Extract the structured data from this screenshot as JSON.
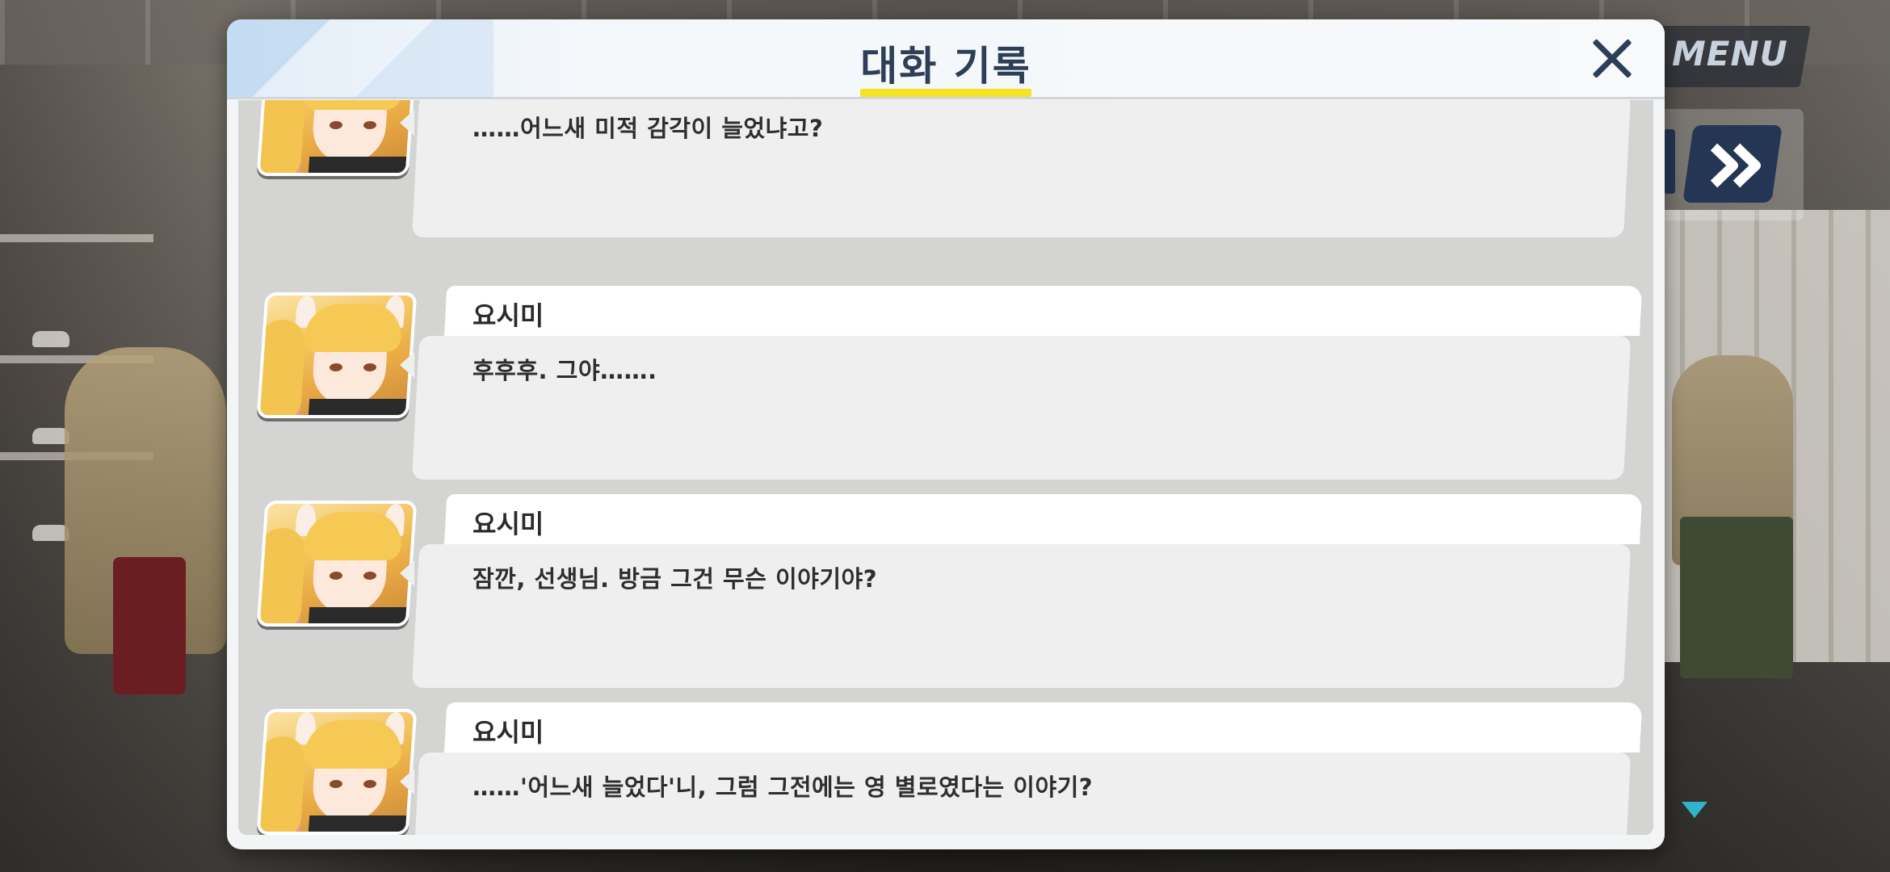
{
  "background": {
    "menu_label": "MENU"
  },
  "dialog": {
    "title": "대화 기록",
    "accent_color": "#f4e224",
    "title_color": "#2c3e58"
  },
  "entries": [
    {
      "speaker": "",
      "message": "……어느새 미적 감각이 늘었냐고?"
    },
    {
      "speaker": "요시미",
      "message": "후후후. 그야……."
    },
    {
      "speaker": "요시미",
      "message": "잠깐, 선생님. 방금 그건 무슨 이야기야?"
    },
    {
      "speaker": "요시미",
      "message": "……'어느새 늘었다'니, 그럼 그전에는 영 별로였다는 이야기?"
    }
  ],
  "icons": {
    "close": "close-icon",
    "skip": "fast-forward-icon",
    "scroll": "scroll-down-icon"
  }
}
